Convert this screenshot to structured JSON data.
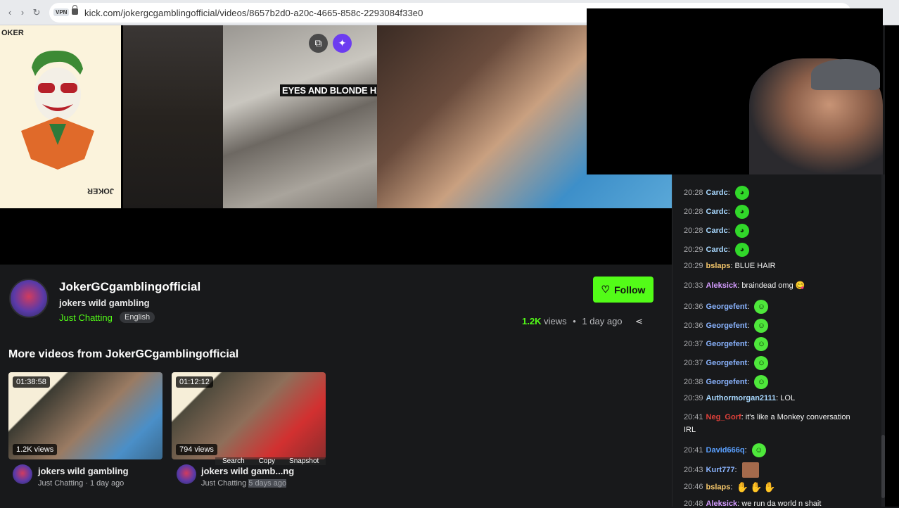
{
  "browser": {
    "url": "kick.com/jokergcgamblingofficial/videos/8657b2d0-a20c-4665-858c-2293084f33e0",
    "vpn_label": "VPN"
  },
  "video": {
    "joker_letters": "OKER",
    "joker_letters_reverse": "JOKER",
    "caption": "EYES AND BLONDE HAI"
  },
  "channel": {
    "name": "JokerGCgamblingofficial",
    "title": "jokers wild gambling",
    "category": "Just Chatting",
    "language": "English",
    "follow_label": "Follow",
    "views": "1.2K",
    "views_word": "views",
    "separator": "•",
    "posted": "1 day ago"
  },
  "more_videos": {
    "heading": "More videos from JokerGCgamblingofficial",
    "items": [
      {
        "duration": "01:38:58",
        "views": "1.2K views",
        "title": "jokers wild gambling",
        "category": "Just Chatting",
        "age": "1 day ago"
      },
      {
        "duration": "01:12:12",
        "views": "794 views",
        "title": "jokers wild gamb...ng",
        "category": "Just Chatting",
        "age": "5 days ago"
      }
    ],
    "context_menu": [
      "Search",
      "Copy",
      "Snapshot"
    ]
  },
  "chat": {
    "messages": [
      {
        "time": "20:28",
        "user": "Cardc",
        "color": "#a8d8ff",
        "text": "",
        "emote": "pepe"
      },
      {
        "time": "20:28",
        "user": "Cardc",
        "color": "#a8d8ff",
        "text": "",
        "emote": "pepe"
      },
      {
        "time": "20:28",
        "user": "Cardc",
        "color": "#a8d8ff",
        "text": "",
        "emote": "pepe"
      },
      {
        "time": "20:29",
        "user": "Cardc",
        "color": "#a8d8ff",
        "text": "",
        "emote": "pepe"
      },
      {
        "time": "20:29",
        "user": "bslaps",
        "color": "#f5c76b",
        "text": "BLUE HAIR",
        "emote": ""
      },
      {
        "time": "20:33",
        "user": "Aleksick",
        "color": "#d49cff",
        "text": "braindead omg 😋",
        "emote": ""
      },
      {
        "time": "20:36",
        "user": "Georgefent",
        "color": "#8ab4ff",
        "text": "",
        "emote": "pepe2"
      },
      {
        "time": "20:36",
        "user": "Georgefent",
        "color": "#8ab4ff",
        "text": "",
        "emote": "pepe2"
      },
      {
        "time": "20:37",
        "user": "Georgefent",
        "color": "#8ab4ff",
        "text": "",
        "emote": "pepe2"
      },
      {
        "time": "20:37",
        "user": "Georgefent",
        "color": "#8ab4ff",
        "text": "",
        "emote": "pepe2"
      },
      {
        "time": "20:38",
        "user": "Georgefent",
        "color": "#8ab4ff",
        "text": "",
        "emote": "pepe2"
      },
      {
        "time": "20:39",
        "user": "Authormorgan2111",
        "color": "#a8d8ff",
        "text": "LOL",
        "emote": ""
      },
      {
        "time": "20:41",
        "user": "Neg_Gorf",
        "color": "#e0403a",
        "text": "it's like a Monkey conversation",
        "emote": ""
      },
      {
        "time": "",
        "user": "",
        "color": "#f2f2f2",
        "text": "IRL",
        "emote": ""
      },
      {
        "time": "20:41",
        "user": "David666q",
        "color": "#5aa0ff",
        "text": "",
        "emote": "pepe3"
      },
      {
        "time": "20:43",
        "user": "Kurt777",
        "color": "#8ab4ff",
        "text": "",
        "emote": "face"
      },
      {
        "time": "20:46",
        "user": "bslaps",
        "color": "#f5c76b",
        "text": "",
        "emote": "hands"
      },
      {
        "time": "20:48",
        "user": "Aleksick",
        "color": "#d49cff",
        "text": "we run da world n shait",
        "emote": ""
      }
    ]
  },
  "colors": {
    "accent": "#53fc18",
    "background": "#18191b"
  },
  "icons": [
    "back-icon",
    "forward-icon",
    "reload-icon",
    "lock-icon",
    "clip-icon",
    "ai-sparkle-icon",
    "heart-icon",
    "share-icon"
  ]
}
